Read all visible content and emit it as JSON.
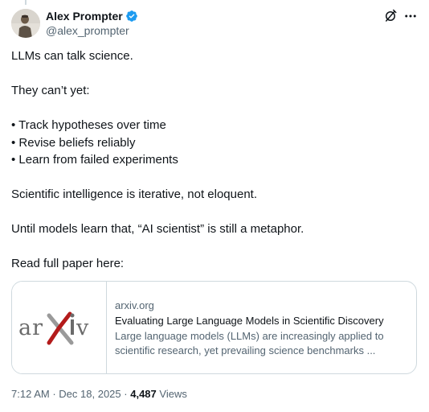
{
  "author": {
    "display_name": "Alex Prompter",
    "handle": "@alex_prompter",
    "verified": true
  },
  "tweet": {
    "paragraphs": [
      "LLMs can talk science.",
      "",
      "They can’t yet:",
      "",
      "• Track hypotheses over time",
      "• Revise beliefs reliably",
      "• Learn from failed experiments",
      "",
      "Scientific intelligence is iterative, not eloquent.",
      "",
      "Until models learn that, “AI scientist” is still a metaphor.",
      "",
      "Read full paper here:"
    ]
  },
  "card": {
    "thumbnail_text": "arXiv",
    "domain": "arxiv.org",
    "title": "Evaluating Large Language Models in Scientific Discovery",
    "description_line1": "Large language models (LLMs) are increasingly applied to",
    "description_line2": "scientific research, yet prevailing science benchmarks ..."
  },
  "meta": {
    "time": "7:12 AM",
    "separator": "·",
    "date": "Dec 18, 2025",
    "views_count": "4,487",
    "views_label": "Views"
  },
  "colors": {
    "verified_blue": "#1d9bf0",
    "arxiv_red": "#b31b1b",
    "secondary_text": "#536471",
    "primary_text": "#0f1419",
    "border": "#cfd9de"
  },
  "icons": {
    "verified": "verified-badge-icon",
    "grok": "grok-icon",
    "more": "more-icon"
  }
}
